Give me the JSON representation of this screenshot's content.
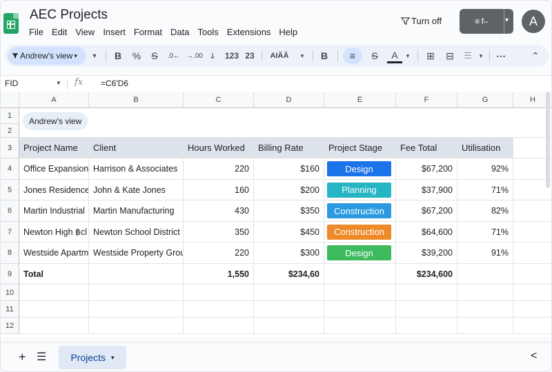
{
  "app": {
    "title": "AEC Projects",
    "menu": [
      "File",
      "Edit",
      "View",
      "Insert",
      "Format",
      "Data",
      "Tools",
      "Extensions",
      "Help"
    ],
    "turn_off_label": "Turn off",
    "share_label": "≡ f–",
    "avatar_letter": "A"
  },
  "toolbar": {
    "view_label": "Andrew's view",
    "percent": "%",
    "dec_decrease": ".0←",
    "dec_increase": "→.00",
    "num_format": "123",
    "font_size": "23",
    "font_name": "AIÄÄ"
  },
  "formula_bar": {
    "name_box": "FID",
    "fx": "fx",
    "formula": "=C6'D6"
  },
  "sheet": {
    "columns": [
      "A",
      "B",
      "C",
      "D",
      "E",
      "F",
      "G",
      "H"
    ],
    "rows": [
      "1",
      "2",
      "3",
      "4",
      "5",
      "6",
      "7",
      "8",
      "9",
      "10",
      "11",
      "12"
    ],
    "view_chip": "Andrew's view",
    "headers": [
      "Project Name",
      "Client",
      "Hours Worked",
      "Billing Rate",
      "Project Stage",
      "Fee Total",
      "Utilisation"
    ],
    "data": [
      {
        "name": "Office Expansion",
        "client": "Harrison & Associates",
        "hours": "220",
        "rate": "$160",
        "stage": "Design",
        "stage_color": "#1a73e8",
        "fee": "$67,200",
        "util": "92%"
      },
      {
        "name": "Jones Residence",
        "client": "John & Kate Jones",
        "hours": "160",
        "rate": "$200",
        "stage": "Planning",
        "stage_color": "#26b5c4",
        "fee": "$37,900",
        "util": "71%"
      },
      {
        "name": "Martin Industrial",
        "client": "Martin Manufacturing",
        "hours": "430",
        "rate": "$350",
        "stage": "Construction",
        "stage_color": "#2a9be0",
        "fee": "$67,200",
        "util": "82%"
      },
      {
        "name": "Newton High ฿cl",
        "client": "Newton School District",
        "hours": "350",
        "rate": "$450",
        "stage": "Construction",
        "stage_color": "#ee8a2a",
        "fee": "$64,600",
        "util": "71%"
      },
      {
        "name": "Westside Apartm",
        "client": "Westside Property Group",
        "hours": "220",
        "rate": "$300",
        "stage": "Design",
        "stage_color": "#3dba5e",
        "fee": "$39,200",
        "util": "91%"
      }
    ],
    "total": {
      "label": "Total",
      "hours": "1,550",
      "rate": "$234,60",
      "fee": "$234,600"
    }
  },
  "bottom": {
    "sheet_tab": "Projects",
    "add_label": "+",
    "collapse_label": "<"
  }
}
